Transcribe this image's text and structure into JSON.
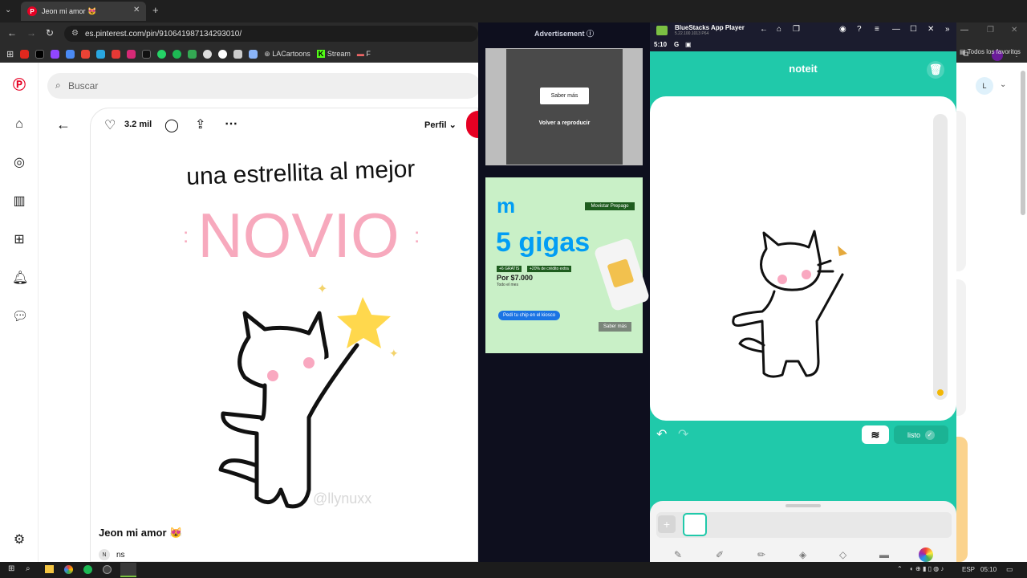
{
  "browser": {
    "tab_title": "Jeon mi amor 😻",
    "url": "es.pinterest.com/pin/910641987134293010/",
    "bookmarks_visible": [
      "LACartoons",
      "Stream",
      "F"
    ],
    "all_bookmarks_label": "Todos los favoritos"
  },
  "pinterest": {
    "search_placeholder": "Buscar",
    "like_count": "3.2 mil",
    "profile_label": "Perfil",
    "pin_title": "Jeon mi amor 😻",
    "user_initial": "N",
    "user_name": "ns",
    "image_text_top": "una estrellita al mejor",
    "image_text_main": "NOVIO",
    "watermark": "@llynuxx"
  },
  "ads": {
    "label": "Advertisement",
    "video_button": "Saber más",
    "video_replay": "Volver a reproducir",
    "banner_badge": "Movistar Prepago",
    "banner_headline": "5 gigas",
    "banner_promo1": "+6 GRATIS",
    "banner_promo2": "+20% de crédito extra",
    "banner_price_prefix": "Por",
    "banner_price": "$7.000",
    "banner_price_note": "Todo el mes",
    "banner_cta": "Pedí tu chip en el kiosco",
    "banner_button": "Saber más"
  },
  "bluestacks": {
    "title": "BlueStacks App Player",
    "version": "5.22.100.1013  P64",
    "time": "5:10",
    "app_name": "noteit",
    "done_label": "listo"
  },
  "right_panel": {
    "avatar_initial": "L"
  },
  "taskbar": {
    "lang": "ESP",
    "time": "05:10"
  }
}
